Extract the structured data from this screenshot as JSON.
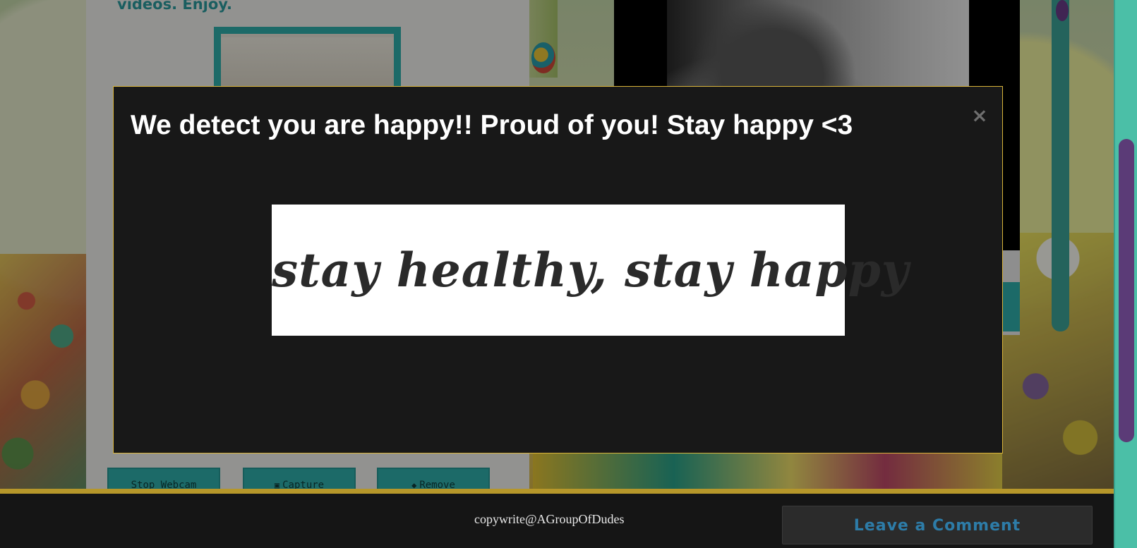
{
  "background": {
    "intro_text": "videos. Enjoy.",
    "buttons": {
      "stop_webcam": "Stop Webcam",
      "capture": "Capture",
      "remove": "Remove"
    },
    "colors": {
      "teal": "#2fb1ad",
      "modal_border": "#d9b43a",
      "footer_bar": "#b6972a"
    }
  },
  "modal": {
    "title": "We detect you are happy!! Proud of you! Stay happy <3",
    "close_label": "×",
    "banner_text": "stay healthy, stay happy"
  },
  "footer": {
    "copyright": "copywrite@AGroupOfDudes",
    "comment_button": "Leave a Comment"
  }
}
